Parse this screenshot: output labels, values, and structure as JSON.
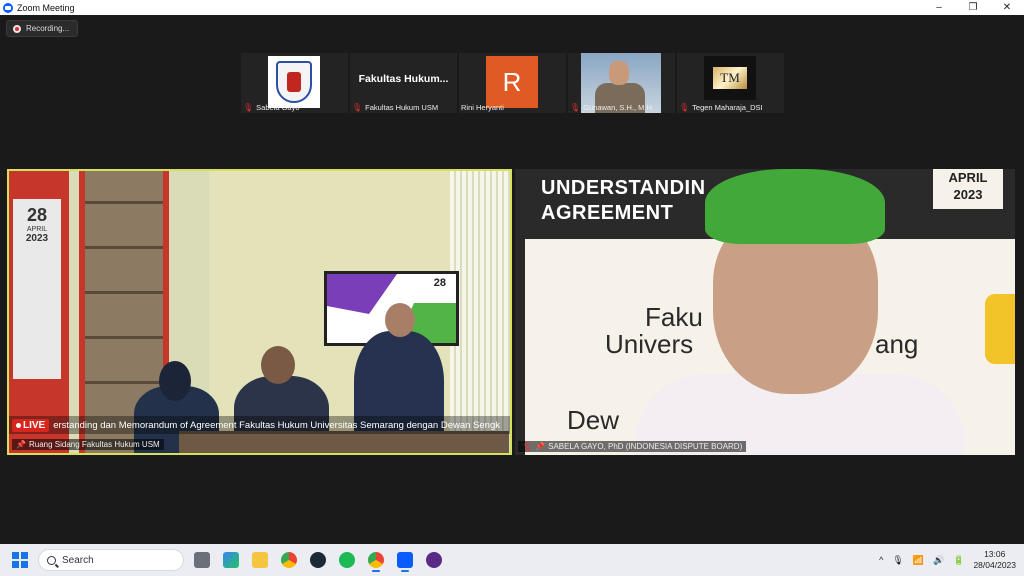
{
  "window": {
    "title": "Zoom Meeting",
    "minimize": "–",
    "maximize": "❐",
    "close": "✕"
  },
  "recording": {
    "label": "Recording..."
  },
  "participants": [
    {
      "name": "Sabela Gayo",
      "mic": "muted",
      "kind": "logo"
    },
    {
      "name": "Fakultas Hukum USM",
      "mic": "muted",
      "kind": "text",
      "display": "Fakultas  Hukum..."
    },
    {
      "name": "Rini Heryanti",
      "mic": "on",
      "kind": "avatar",
      "initial": "R"
    },
    {
      "name": "Gunawan, S.H., M.H.",
      "mic": "muted",
      "kind": "video"
    },
    {
      "name": "Tegen Maharaja_DSI",
      "mic": "muted",
      "kind": "logo-tm",
      "mark": "TM"
    }
  ],
  "main_left": {
    "name": "Ruang Sidang Fakultas Hukum USM",
    "live_label": "LIVE",
    "ticker": "erstanding dan Memorandum of Agreement Fakultas Hukum Universitas Semarang dengan Dewan Sengk",
    "banner_day": "28",
    "banner_month": "APRIL",
    "banner_year": "2023",
    "screen_day": "28"
  },
  "main_right": {
    "name": "SABELA GAYO, PhD (INDONESIA DISPUTE BOARD)",
    "slide_line1": "UNDERSTANDIN",
    "slide_line2": "AGREEMENT",
    "slide_month": "APRIL",
    "slide_year": "2023",
    "slide_t1": "Faku",
    "slide_t2": "Univers",
    "slide_t3": "ang",
    "slide_t4": "Dew"
  },
  "taskbar": {
    "search_label": "Search",
    "time": "13:06",
    "date": "28/04/2023",
    "tray_up": "^"
  },
  "colors": {
    "zoom_blue": "#0b5cff",
    "active_border": "#d6e05a",
    "live_red": "#d8261c",
    "mic_muted": "#e0312f"
  }
}
